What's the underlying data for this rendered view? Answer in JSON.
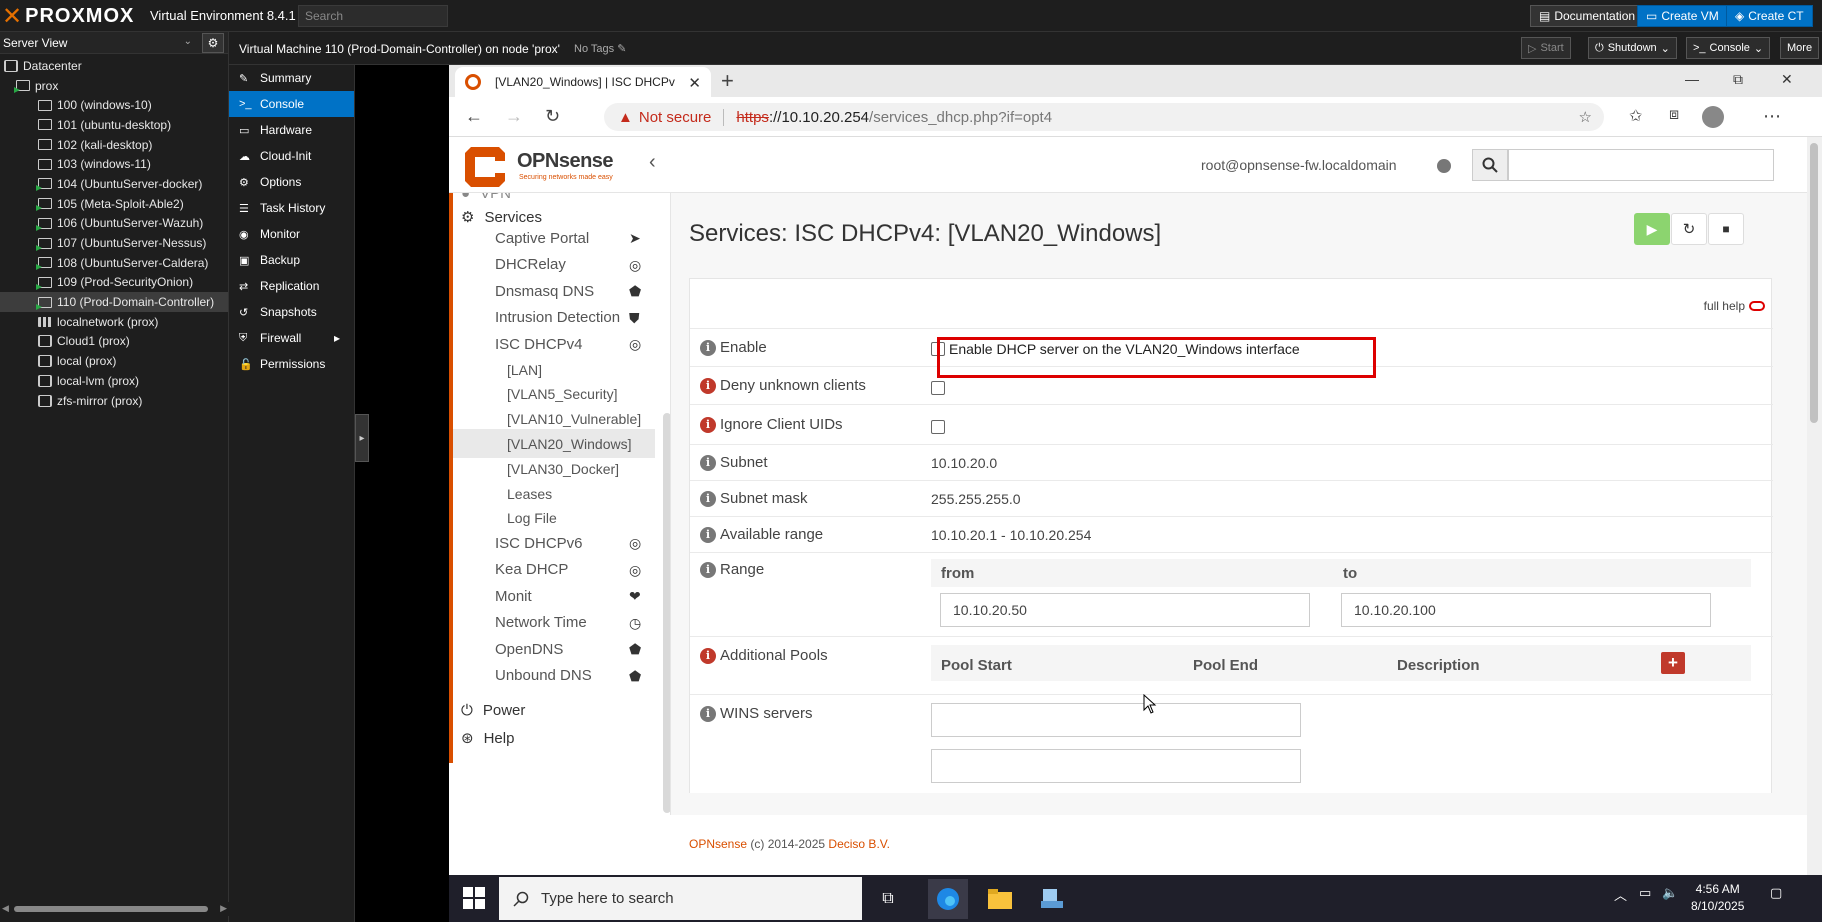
{
  "pve": {
    "brand": "PROXMOX",
    "version": "Virtual Environment 8.4.1",
    "search_placeholder": "Search",
    "buttons": {
      "documentation": "Documentation",
      "create_vm": "Create VM",
      "create_ct": "Create CT"
    }
  },
  "tree": {
    "view": "Server View",
    "items": [
      {
        "label": "Datacenter",
        "kind": "dc"
      },
      {
        "label": "prox",
        "kind": "node"
      },
      {
        "label": "100 (windows-10)",
        "kind": "vm"
      },
      {
        "label": "101 (ubuntu-desktop)",
        "kind": "vm"
      },
      {
        "label": "102 (kali-desktop)",
        "kind": "vm"
      },
      {
        "label": "103 (windows-11)",
        "kind": "vm"
      },
      {
        "label": "104 (UbuntuServer-docker)",
        "kind": "vm-run"
      },
      {
        "label": "105 (Meta-Sploit-Able2)",
        "kind": "vm-run"
      },
      {
        "label": "106 (UbuntuServer-Wazuh)",
        "kind": "vm-run"
      },
      {
        "label": "107 (UbuntuServer-Nessus)",
        "kind": "vm-run"
      },
      {
        "label": "108 (UbuntuServer-Caldera)",
        "kind": "vm-run"
      },
      {
        "label": "109 (Prod-SecurityOnion)",
        "kind": "vm-run"
      },
      {
        "label": "110 (Prod-Domain-Controller)",
        "kind": "vm-run",
        "selected": true
      },
      {
        "label": "localnetwork (prox)",
        "kind": "net"
      },
      {
        "label": "Cloud1 (prox)",
        "kind": "store"
      },
      {
        "label": "local (prox)",
        "kind": "store"
      },
      {
        "label": "local-lvm (prox)",
        "kind": "store"
      },
      {
        "label": "zfs-mirror (prox)",
        "kind": "store"
      }
    ]
  },
  "vmhead": {
    "title": "Virtual Machine 110 (Prod-Domain-Controller) on node 'prox'",
    "tags": "No Tags",
    "start": "Start",
    "shutdown": "Shutdown",
    "console": "Console",
    "more": "More"
  },
  "vmmenu": [
    "Summary",
    "Console",
    "Hardware",
    "Cloud-Init",
    "Options",
    "Task History",
    "Monitor",
    "Backup",
    "Replication",
    "Snapshots",
    "Firewall",
    "Permissions"
  ],
  "browser": {
    "tab_title": "[VLAN20_Windows] | ISC DHCPv",
    "not_secure": "Not secure",
    "url_proto": "https",
    "url_host": "://10.10.20.254",
    "url_path": "/services_dhcp.php?if=opt4"
  },
  "opn": {
    "name": "OPNsense",
    "slogan": "Securing networks made easy",
    "user": "root@opnsense-fw.localdomain",
    "sidebar": {
      "vpn": "VPN",
      "services": "Services",
      "items": [
        "Captive Portal",
        "DHCRelay",
        "Dnsmasq DNS",
        "Intrusion Detection",
        "ISC DHCPv4"
      ],
      "sub": [
        "[LAN]",
        "[VLAN5_Security]",
        "[VLAN10_Vulnerable]",
        "[VLAN20_Windows]",
        "[VLAN30_Docker]",
        "Leases",
        "Log File"
      ],
      "items2": [
        "ISC DHCPv6",
        "Kea DHCP",
        "Monit",
        "Network Time",
        "OpenDNS",
        "Unbound DNS"
      ],
      "power": "Power",
      "help": "Help"
    },
    "page_title": "Services: ISC DHCPv4: [VLAN20_Windows]",
    "full_help": "full help",
    "form": {
      "enable_label": "Enable",
      "enable_text": "Enable DHCP server on the VLAN20_Windows interface",
      "deny_label": "Deny unknown clients",
      "ignore_label": "Ignore Client UIDs",
      "subnet_label": "Subnet",
      "subnet_value": "10.10.20.0",
      "mask_label": "Subnet mask",
      "mask_value": "255.255.255.0",
      "avail_label": "Available range",
      "avail_value": "10.10.20.1 - 10.10.20.254",
      "range_label": "Range",
      "from": "from",
      "to": "to",
      "from_value": "10.10.20.50",
      "to_value": "10.10.20.100",
      "pools_label": "Additional Pools",
      "pool_start": "Pool Start",
      "pool_end": "Pool End",
      "pool_desc": "Description",
      "wins_label": "WINS servers"
    },
    "footer_a": "OPNsense",
    "footer_b": " (c) 2014-2025 ",
    "footer_c": "Deciso B.V."
  },
  "taskbar": {
    "search": "Type here to search",
    "time": "4:56 AM",
    "date": "8/10/2025"
  }
}
